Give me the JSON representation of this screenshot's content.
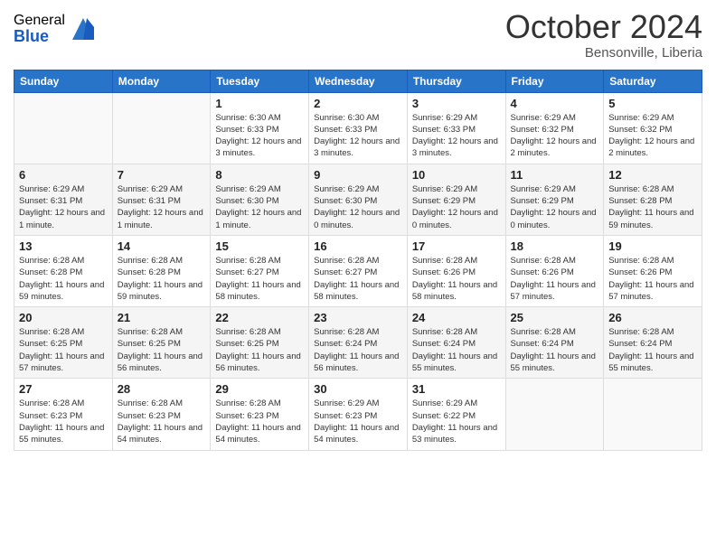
{
  "logo": {
    "general": "General",
    "blue": "Blue"
  },
  "title": "October 2024",
  "subtitle": "Bensonville, Liberia",
  "days_of_week": [
    "Sunday",
    "Monday",
    "Tuesday",
    "Wednesday",
    "Thursday",
    "Friday",
    "Saturday"
  ],
  "weeks": [
    [
      {
        "day": "",
        "info": ""
      },
      {
        "day": "",
        "info": ""
      },
      {
        "day": "1",
        "info": "Sunrise: 6:30 AM\nSunset: 6:33 PM\nDaylight: 12 hours and 3 minutes."
      },
      {
        "day": "2",
        "info": "Sunrise: 6:30 AM\nSunset: 6:33 PM\nDaylight: 12 hours and 3 minutes."
      },
      {
        "day": "3",
        "info": "Sunrise: 6:29 AM\nSunset: 6:33 PM\nDaylight: 12 hours and 3 minutes."
      },
      {
        "day": "4",
        "info": "Sunrise: 6:29 AM\nSunset: 6:32 PM\nDaylight: 12 hours and 2 minutes."
      },
      {
        "day": "5",
        "info": "Sunrise: 6:29 AM\nSunset: 6:32 PM\nDaylight: 12 hours and 2 minutes."
      }
    ],
    [
      {
        "day": "6",
        "info": "Sunrise: 6:29 AM\nSunset: 6:31 PM\nDaylight: 12 hours and 1 minute."
      },
      {
        "day": "7",
        "info": "Sunrise: 6:29 AM\nSunset: 6:31 PM\nDaylight: 12 hours and 1 minute."
      },
      {
        "day": "8",
        "info": "Sunrise: 6:29 AM\nSunset: 6:30 PM\nDaylight: 12 hours and 1 minute."
      },
      {
        "day": "9",
        "info": "Sunrise: 6:29 AM\nSunset: 6:30 PM\nDaylight: 12 hours and 0 minutes."
      },
      {
        "day": "10",
        "info": "Sunrise: 6:29 AM\nSunset: 6:29 PM\nDaylight: 12 hours and 0 minutes."
      },
      {
        "day": "11",
        "info": "Sunrise: 6:29 AM\nSunset: 6:29 PM\nDaylight: 12 hours and 0 minutes."
      },
      {
        "day": "12",
        "info": "Sunrise: 6:28 AM\nSunset: 6:28 PM\nDaylight: 11 hours and 59 minutes."
      }
    ],
    [
      {
        "day": "13",
        "info": "Sunrise: 6:28 AM\nSunset: 6:28 PM\nDaylight: 11 hours and 59 minutes."
      },
      {
        "day": "14",
        "info": "Sunrise: 6:28 AM\nSunset: 6:28 PM\nDaylight: 11 hours and 59 minutes."
      },
      {
        "day": "15",
        "info": "Sunrise: 6:28 AM\nSunset: 6:27 PM\nDaylight: 11 hours and 58 minutes."
      },
      {
        "day": "16",
        "info": "Sunrise: 6:28 AM\nSunset: 6:27 PM\nDaylight: 11 hours and 58 minutes."
      },
      {
        "day": "17",
        "info": "Sunrise: 6:28 AM\nSunset: 6:26 PM\nDaylight: 11 hours and 58 minutes."
      },
      {
        "day": "18",
        "info": "Sunrise: 6:28 AM\nSunset: 6:26 PM\nDaylight: 11 hours and 57 minutes."
      },
      {
        "day": "19",
        "info": "Sunrise: 6:28 AM\nSunset: 6:26 PM\nDaylight: 11 hours and 57 minutes."
      }
    ],
    [
      {
        "day": "20",
        "info": "Sunrise: 6:28 AM\nSunset: 6:25 PM\nDaylight: 11 hours and 57 minutes."
      },
      {
        "day": "21",
        "info": "Sunrise: 6:28 AM\nSunset: 6:25 PM\nDaylight: 11 hours and 56 minutes."
      },
      {
        "day": "22",
        "info": "Sunrise: 6:28 AM\nSunset: 6:25 PM\nDaylight: 11 hours and 56 minutes."
      },
      {
        "day": "23",
        "info": "Sunrise: 6:28 AM\nSunset: 6:24 PM\nDaylight: 11 hours and 56 minutes."
      },
      {
        "day": "24",
        "info": "Sunrise: 6:28 AM\nSunset: 6:24 PM\nDaylight: 11 hours and 55 minutes."
      },
      {
        "day": "25",
        "info": "Sunrise: 6:28 AM\nSunset: 6:24 PM\nDaylight: 11 hours and 55 minutes."
      },
      {
        "day": "26",
        "info": "Sunrise: 6:28 AM\nSunset: 6:24 PM\nDaylight: 11 hours and 55 minutes."
      }
    ],
    [
      {
        "day": "27",
        "info": "Sunrise: 6:28 AM\nSunset: 6:23 PM\nDaylight: 11 hours and 55 minutes."
      },
      {
        "day": "28",
        "info": "Sunrise: 6:28 AM\nSunset: 6:23 PM\nDaylight: 11 hours and 54 minutes."
      },
      {
        "day": "29",
        "info": "Sunrise: 6:28 AM\nSunset: 6:23 PM\nDaylight: 11 hours and 54 minutes."
      },
      {
        "day": "30",
        "info": "Sunrise: 6:29 AM\nSunset: 6:23 PM\nDaylight: 11 hours and 54 minutes."
      },
      {
        "day": "31",
        "info": "Sunrise: 6:29 AM\nSunset: 6:22 PM\nDaylight: 11 hours and 53 minutes."
      },
      {
        "day": "",
        "info": ""
      },
      {
        "day": "",
        "info": ""
      }
    ]
  ]
}
